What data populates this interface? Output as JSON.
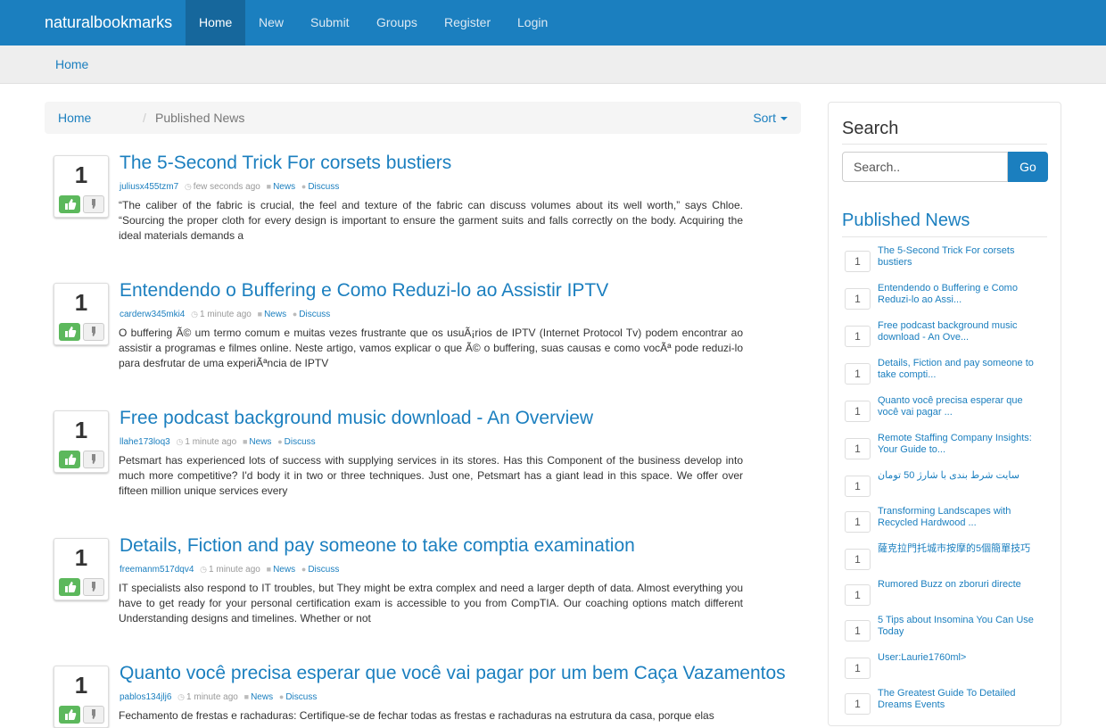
{
  "nav": {
    "brand": "naturalbookmarks",
    "items": [
      {
        "label": "Home"
      },
      {
        "label": "New"
      },
      {
        "label": "Submit"
      },
      {
        "label": "Groups"
      },
      {
        "label": "Register"
      },
      {
        "label": "Login"
      }
    ],
    "active_item": "Home"
  },
  "top_breadcrumb": "Home",
  "breadcrumb": {
    "home": "Home",
    "separator": "/",
    "current": "Published News",
    "sort_label": "Sort"
  },
  "posts": [
    {
      "votes": "1",
      "title": "The 5-Second Trick For corsets bustiers",
      "author": "juliusx455tzm7",
      "time": "few seconds ago",
      "category": "News",
      "discuss": "Discuss",
      "excerpt": "“The caliber of the fabric is crucial, the feel and texture of the fabric can discuss volumes about its well worth,” says Chloe. “Sourcing the proper cloth for every design is important to ensure the garment suits and falls correctly on the body. Acquiring the ideal materials demands a"
    },
    {
      "votes": "1",
      "title": "Entendendo o Buffering e Como Reduzi-lo ao Assistir IPTV",
      "author": "carderw345mki4",
      "time": "1 minute ago",
      "category": "News",
      "discuss": "Discuss",
      "excerpt": "O buffering Ã© um termo comum e muitas vezes frustrante que os usuÃ¡rios de IPTV (Internet Protocol Tv) podem encontrar ao assistir a programas e filmes online. Neste artigo, vamos explicar o que Ã© o buffering, suas causas e como vocÃª pode reduzi-lo para desfrutar de uma experiÃªncia de IPTV"
    },
    {
      "votes": "1",
      "title": "Free podcast background music download - An Overview",
      "author": "llahe173loq3",
      "time": "1 minute ago",
      "category": "News",
      "discuss": "Discuss",
      "excerpt": "Petsmart has experienced lots of success with supplying services in its stores. Has this Component of the business develop into much more competitive? I'd body it in two or three techniques. Just one, Petsmart has a giant lead in this space. We offer over fifteen million unique services every"
    },
    {
      "votes": "1",
      "title": "Details, Fiction and pay someone to take comptia examination",
      "author": "freemanm517dqv4",
      "time": "1 minute ago",
      "category": "News",
      "discuss": "Discuss",
      "excerpt": "IT specialists also respond to IT troubles, but They might be extra complex and need a larger depth of data. Almost everything you have to get ready for your personal certification exam is accessible to you from CompTIA. Our coaching options match different Understanding designs and timelines. Whether or not"
    },
    {
      "votes": "1",
      "title": "Quanto você precisa esperar que você vai pagar por um bem Caça Vazamentos",
      "author": "pablos134jlj6",
      "time": "1 minute ago",
      "category": "News",
      "discuss": "Discuss",
      "excerpt": "Fechamento de frestas e rachaduras: Certifique-se de fechar todas as frestas e rachaduras na estrutura da casa, porque elas"
    }
  ],
  "sidebar": {
    "search_heading": "Search",
    "search_placeholder": "Search..",
    "go_label": "Go",
    "published_heading": "Published News",
    "items": [
      {
        "count": "1",
        "title": "The 5-Second Trick For corsets bustiers"
      },
      {
        "count": "1",
        "title": "Entendendo o Buffering e Como Reduzi-lo ao Assi..."
      },
      {
        "count": "1",
        "title": "Free podcast background music download - An Ove..."
      },
      {
        "count": "1",
        "title": "Details, Fiction and pay someone to take compti..."
      },
      {
        "count": "1",
        "title": "Quanto você precisa esperar que você vai pagar ..."
      },
      {
        "count": "1",
        "title": "Remote Staffing Company Insights: Your Guide to..."
      },
      {
        "count": "1",
        "title": "سایت شرط بندی با شارژ 50 تومان"
      },
      {
        "count": "1",
        "title": "Transforming Landscapes with Recycled Hardwood ..."
      },
      {
        "count": "1",
        "title": "薩克拉門托城市按摩的5個簡單技巧"
      },
      {
        "count": "1",
        "title": "Rumored Buzz on zboruri directe"
      },
      {
        "count": "1",
        "title": "5 Tips about Insomina You Can Use Today"
      },
      {
        "count": "1",
        "title": "User:Laurie1760ml>"
      },
      {
        "count": "1",
        "title": "The Greatest Guide To Detailed Dreams Events"
      }
    ]
  },
  "colors": {
    "brand": "#1b7fbf",
    "upvote": "#5cb85c"
  }
}
